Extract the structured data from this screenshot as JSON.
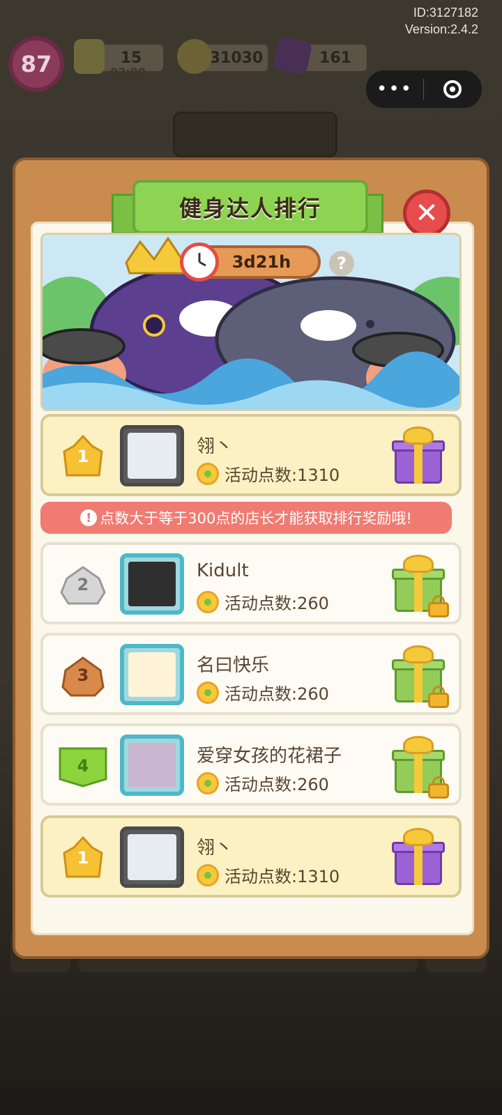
{
  "meta": {
    "id_text": "ID:3127182",
    "version_text": "Version:2.4.2"
  },
  "hud": {
    "level": "87",
    "energy": "15",
    "energy_timer": "02:00",
    "coins": "31030",
    "gems": "161"
  },
  "dialog": {
    "title": "健身达人排行",
    "countdown": "3d21h",
    "help_label": "?"
  },
  "notice": {
    "text": "点数大于等于300点的店长才能获取排行奖励哦!"
  },
  "ranking": [
    {
      "rank": "1",
      "name": "翎丶",
      "points": "活动点数:1310",
      "reward": "purple-gift-icon",
      "locked": false
    },
    {
      "rank": "2",
      "name": "Kidult",
      "points": "活动点数:260",
      "reward": "green-gift-icon",
      "locked": true
    },
    {
      "rank": "3",
      "name": "名曰快乐",
      "points": "活动点数:260",
      "reward": "green-gift-icon",
      "locked": true
    },
    {
      "rank": "4",
      "name": "爱穿女孩的花裙子",
      "points": "活动点数:260",
      "reward": "green-gift-icon",
      "locked": true
    }
  ],
  "my_rank": {
    "rank": "1",
    "name": "翎丶",
    "points": "活动点数:1310",
    "reward": "purple-gift-icon"
  },
  "colors": {
    "ribbon_green": "#8dd453",
    "panel_orange": "#c98c4e",
    "notice_red": "#ef7b72",
    "gold_badge": "#f2b52e",
    "silver_badge": "#c8c8c8",
    "bronze_badge": "#d48a4e",
    "green_badge": "#8bd43c"
  }
}
